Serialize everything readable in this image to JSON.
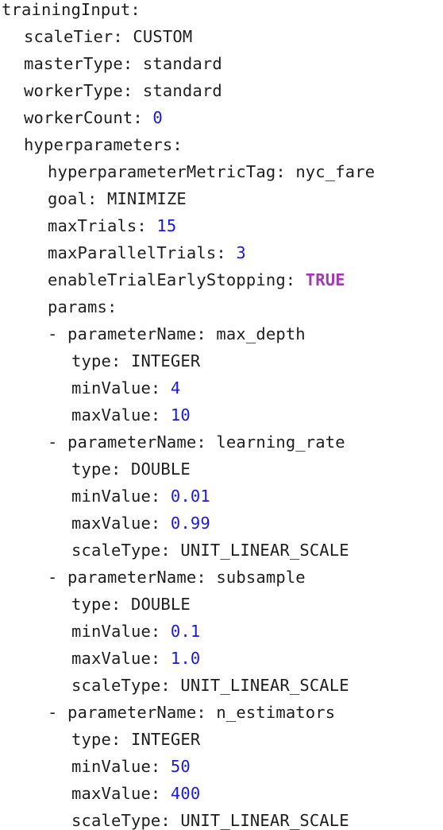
{
  "colors": {
    "text": "#1e1e1e",
    "number": "#1a1ad6",
    "boolean": "#a03ab0",
    "background": "#ffffff"
  },
  "lines": [
    {
      "key": "trainingInput:",
      "value": "",
      "kind": "plain"
    },
    {
      "key": "scaleTier: ",
      "value": "CUSTOM",
      "kind": "plain"
    },
    {
      "key": "masterType: ",
      "value": "standard",
      "kind": "plain"
    },
    {
      "key": "workerType: ",
      "value": "standard",
      "kind": "plain"
    },
    {
      "key": "workerCount: ",
      "value": "0",
      "kind": "num"
    },
    {
      "key": "hyperparameters:",
      "value": "",
      "kind": "plain"
    },
    {
      "key": "hyperparameterMetricTag: ",
      "value": "nyc_fare",
      "kind": "plain"
    },
    {
      "key": "goal: ",
      "value": "MINIMIZE",
      "kind": "plain"
    },
    {
      "key": "maxTrials: ",
      "value": "15",
      "kind": "num"
    },
    {
      "key": "maxParallelTrials: ",
      "value": "3",
      "kind": "num"
    },
    {
      "key": "enableTrialEarlyStopping: ",
      "value": "TRUE",
      "kind": "bool"
    },
    {
      "key": "params:",
      "value": "",
      "kind": "plain"
    },
    {
      "key": "- parameterName: ",
      "value": "max_depth",
      "kind": "plain"
    },
    {
      "key": "type: ",
      "value": "INTEGER",
      "kind": "plain"
    },
    {
      "key": "minValue: ",
      "value": "4",
      "kind": "num"
    },
    {
      "key": "maxValue: ",
      "value": "10",
      "kind": "num"
    },
    {
      "key": "- parameterName: ",
      "value": "learning_rate",
      "kind": "plain"
    },
    {
      "key": "type: ",
      "value": "DOUBLE",
      "kind": "plain"
    },
    {
      "key": "minValue: ",
      "value": "0.01",
      "kind": "num"
    },
    {
      "key": "maxValue: ",
      "value": "0.99",
      "kind": "num"
    },
    {
      "key": "scaleType: ",
      "value": "UNIT_LINEAR_SCALE",
      "kind": "plain"
    },
    {
      "key": "- parameterName: ",
      "value": "subsample",
      "kind": "plain"
    },
    {
      "key": "type: ",
      "value": "DOUBLE",
      "kind": "plain"
    },
    {
      "key": "minValue: ",
      "value": "0.1",
      "kind": "num"
    },
    {
      "key": "maxValue: ",
      "value": "1.0",
      "kind": "num"
    },
    {
      "key": "scaleType: ",
      "value": "UNIT_LINEAR_SCALE",
      "kind": "plain"
    },
    {
      "key": "- parameterName: ",
      "value": "n_estimators",
      "kind": "plain"
    },
    {
      "key": "type: ",
      "value": "INTEGER",
      "kind": "plain"
    },
    {
      "key": "minValue: ",
      "value": "50",
      "kind": "num"
    },
    {
      "key": "maxValue: ",
      "value": "400",
      "kind": "num"
    },
    {
      "key": "scaleType: ",
      "value": "UNIT_LINEAR_SCALE",
      "kind": "plain"
    }
  ]
}
